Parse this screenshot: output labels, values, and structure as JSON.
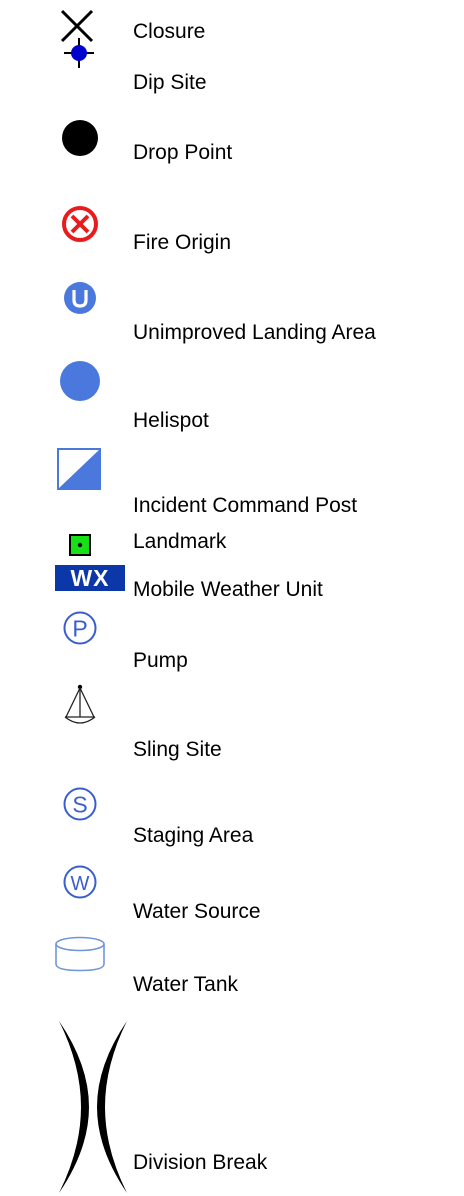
{
  "colors": {
    "black": "#000000",
    "fire_red": "#e81c1c",
    "dip_blue": "#0000cc",
    "map_blue": "#4a78dd",
    "landmark_green": "#18e018",
    "wx_navy": "#0b37a8",
    "symbol_blue": "#3a5fcd",
    "tank_blue": "#6f95dc"
  },
  "legend": {
    "items": [
      {
        "label": "Closure",
        "icon": "x-cross-icon"
      },
      {
        "label": "Dip Site",
        "icon": "crosshair-dot-icon"
      },
      {
        "label": "Drop Point",
        "icon": "black-dot-icon"
      },
      {
        "label": "Fire Origin",
        "icon": "circled-x-icon"
      },
      {
        "label": "Unimproved Landing Area",
        "icon": "u-circle-icon"
      },
      {
        "label": "Helispot",
        "icon": "blue-circle-icon"
      },
      {
        "label": "Incident Command Post",
        "icon": "half-square-icon"
      },
      {
        "label": "Landmark",
        "icon": "green-square-dot-icon"
      },
      {
        "label": "Mobile Weather Unit",
        "icon": "wx-badge-icon",
        "badge_text": "WX"
      },
      {
        "label": "Pump",
        "icon": "circle-p-icon",
        "glyph": "P"
      },
      {
        "label": "Sling Site",
        "icon": "sling-load-icon"
      },
      {
        "label": "Staging Area",
        "icon": "circle-s-icon",
        "glyph": "S"
      },
      {
        "label": "Water Source",
        "icon": "circle-w-icon",
        "glyph": "W"
      },
      {
        "label": "Water Tank",
        "icon": "cylinder-tank-icon"
      },
      {
        "label": "Division Break",
        "icon": "division-break-icon"
      }
    ]
  }
}
